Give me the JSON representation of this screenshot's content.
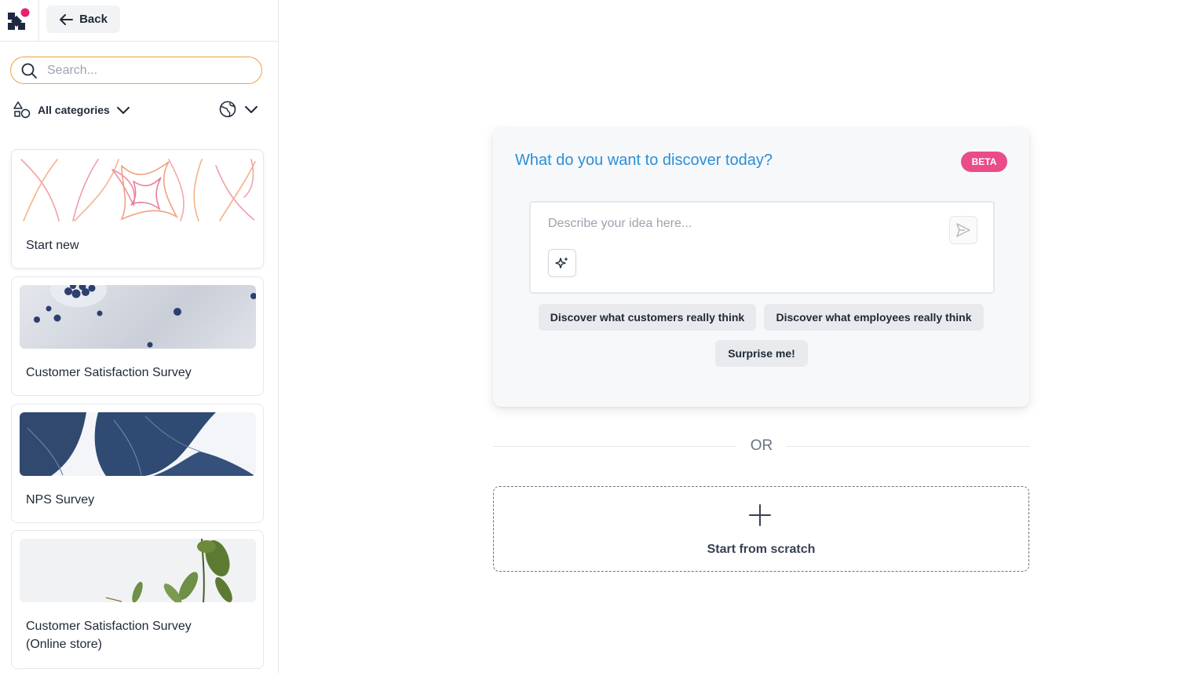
{
  "topbar": {
    "back_label": "Back"
  },
  "search": {
    "placeholder": "Search..."
  },
  "filters": {
    "category_label": "All categories"
  },
  "templates": [
    {
      "title": "Start new"
    },
    {
      "title": "Customer Satisfaction Survey"
    },
    {
      "title": "NPS Survey"
    },
    {
      "title": "Customer Satisfaction Survey (Online store)"
    }
  ],
  "ai_panel": {
    "headline": "What do you want to discover today?",
    "badge": "BETA",
    "input_placeholder": "Describe your idea here...",
    "suggestions": [
      "Discover what customers really think",
      "Discover what employees really think",
      "Surprise me!"
    ]
  },
  "divider": {
    "or_label": "OR"
  },
  "scratch": {
    "label": "Start from scratch"
  },
  "colors": {
    "brand_pink": "#ea4c89",
    "headline_blue": "#2b8fd8",
    "search_focus": "#f0a040"
  }
}
